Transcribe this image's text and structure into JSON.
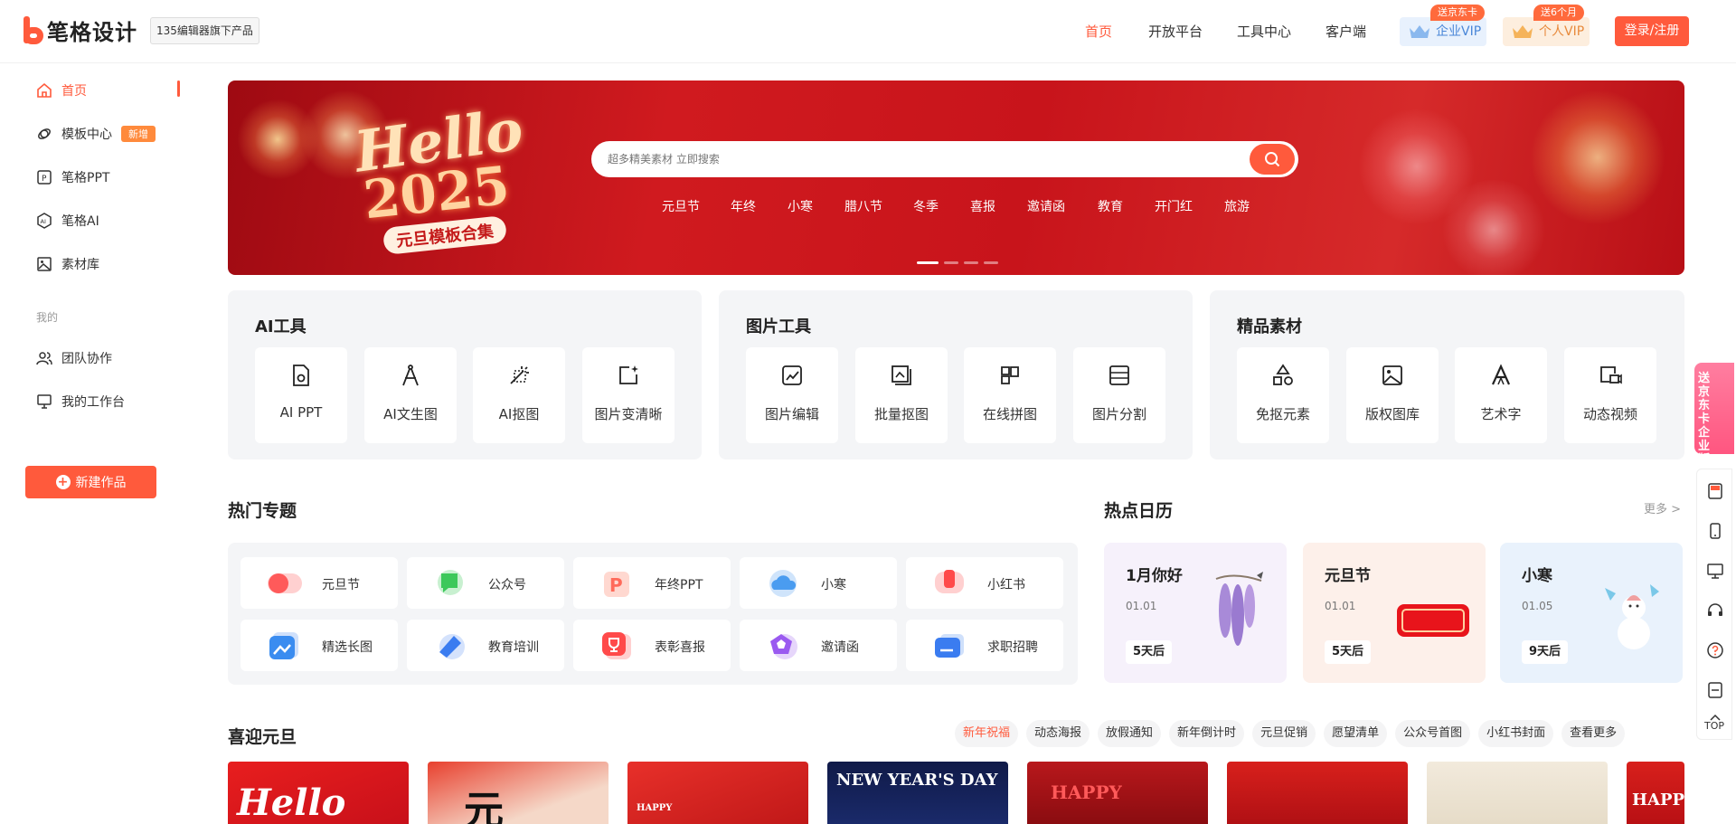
{
  "header": {
    "logo_text": "笔格设计",
    "logo_tag": "135编辑器旗下产品",
    "nav": [
      "首页",
      "开放平台",
      "工具中心",
      "客户端"
    ],
    "vip_enterprise": {
      "label": "企业VIP",
      "badge": "送京东卡"
    },
    "vip_personal": {
      "label": "个人VIP",
      "badge": "送6个月"
    },
    "login_label": "登录/注册",
    "accent": "#ff5a3c"
  },
  "sidebar": {
    "items": [
      {
        "label": "首页",
        "icon": "home-icon"
      },
      {
        "label": "模板中心",
        "icon": "template-icon",
        "tag": "新增"
      },
      {
        "label": "笔格PPT",
        "icon": "ppt-icon"
      },
      {
        "label": "笔格AI",
        "icon": "ai-icon"
      },
      {
        "label": "素材库",
        "icon": "image-icon"
      }
    ],
    "section_label": "我的",
    "my_items": [
      {
        "label": "团队协作",
        "icon": "team-icon"
      },
      {
        "label": "我的工作台",
        "icon": "monitor-icon"
      }
    ],
    "new_button": "新建作品"
  },
  "banner": {
    "hello": "Hello",
    "year": "2025",
    "subtitle": "元旦模板合集",
    "search_placeholder": "超多精美素材 立即搜索",
    "keywords": [
      "元旦节",
      "年终",
      "小寒",
      "腊八节",
      "冬季",
      "喜报",
      "邀请函",
      "教育",
      "开门红",
      "旅游"
    ]
  },
  "panels": [
    {
      "title": "AI工具",
      "tools": [
        "AI PPT",
        "AI文生图",
        "AI抠图",
        "图片变清晰"
      ]
    },
    {
      "title": "图片工具",
      "tools": [
        "图片编辑",
        "批量抠图",
        "在线拼图",
        "图片分割"
      ]
    },
    {
      "title": "精品素材",
      "tools": [
        "免抠元素",
        "版权图库",
        "艺术字",
        "动态视频"
      ]
    }
  ],
  "topics": {
    "title": "热门专题",
    "items": [
      {
        "label": "元旦节",
        "color": "#ff5a5a"
      },
      {
        "label": "公众号",
        "color": "#3cc85a"
      },
      {
        "label": "年终PPT",
        "color": "#ff7a6a"
      },
      {
        "label": "小寒",
        "color": "#4a9cf0"
      },
      {
        "label": "小红书",
        "color": "#ff4a4a"
      },
      {
        "label": "精选长图",
        "color": "#3a8cf0"
      },
      {
        "label": "教育培训",
        "color": "#3a7cf0"
      },
      {
        "label": "表彰喜报",
        "color": "#ff4a4a"
      },
      {
        "label": "邀请函",
        "color": "#9a5af0"
      },
      {
        "label": "求职招聘",
        "color": "#3a7cf0"
      }
    ]
  },
  "calendar": {
    "title": "热点日历",
    "more": "更多 >",
    "items": [
      {
        "title": "1月你好",
        "date": "01.01",
        "remain": "5天后",
        "bg": "#f6f1fb"
      },
      {
        "title": "元旦节",
        "date": "01.01",
        "remain": "5天后",
        "bg": "#fdf0ea"
      },
      {
        "title": "小寒",
        "date": "01.05",
        "remain": "9天后",
        "bg": "#e9f2fc"
      }
    ]
  },
  "newyear": {
    "title": "喜迎元旦",
    "chips": [
      "新年祝福",
      "动态海报",
      "放假通知",
      "新年倒计时",
      "元旦促销",
      "愿望清单",
      "公众号首图",
      "小红书封面",
      "查看更多"
    ],
    "thumbs": [
      "Hello",
      "元",
      "HAPPY",
      "NEW YEAR'S DAY",
      "HAPPY",
      "",
      "",
      "HAPP"
    ]
  },
  "rail": {
    "promo": "送京东卡企业版",
    "top": "TOP"
  }
}
